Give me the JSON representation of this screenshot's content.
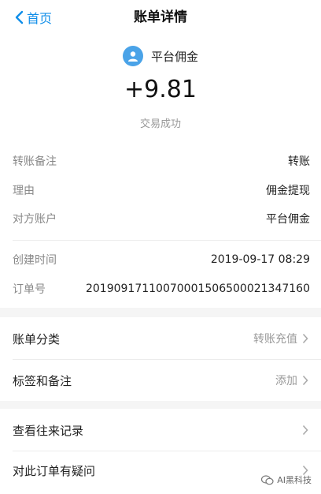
{
  "nav": {
    "back_label": "首页",
    "title": "账单详情"
  },
  "summary": {
    "payee": "平台佣金",
    "amount": "+9.81",
    "status": "交易成功"
  },
  "details": {
    "rows": [
      {
        "label": "转账备注",
        "value": "转账"
      },
      {
        "label": "理由",
        "value": "佣金提现"
      },
      {
        "label": "对方账户",
        "value": "平台佣金"
      },
      {
        "label": "创建时间",
        "value": "2019-09-17 08:29"
      },
      {
        "label": "订单号",
        "value": "20190917110070001506500021347160"
      }
    ]
  },
  "actions": [
    {
      "label": "账单分类",
      "value": "转账充值"
    },
    {
      "label": "标签和备注",
      "value": "添加"
    },
    {
      "label": "查看往来记录",
      "value": ""
    },
    {
      "label": "对此订单有疑问",
      "value": ""
    }
  ],
  "watermark": {
    "text": "AI黑科技"
  },
  "colors": {
    "accent": "#108ee9",
    "background": "#f5f5f5"
  }
}
